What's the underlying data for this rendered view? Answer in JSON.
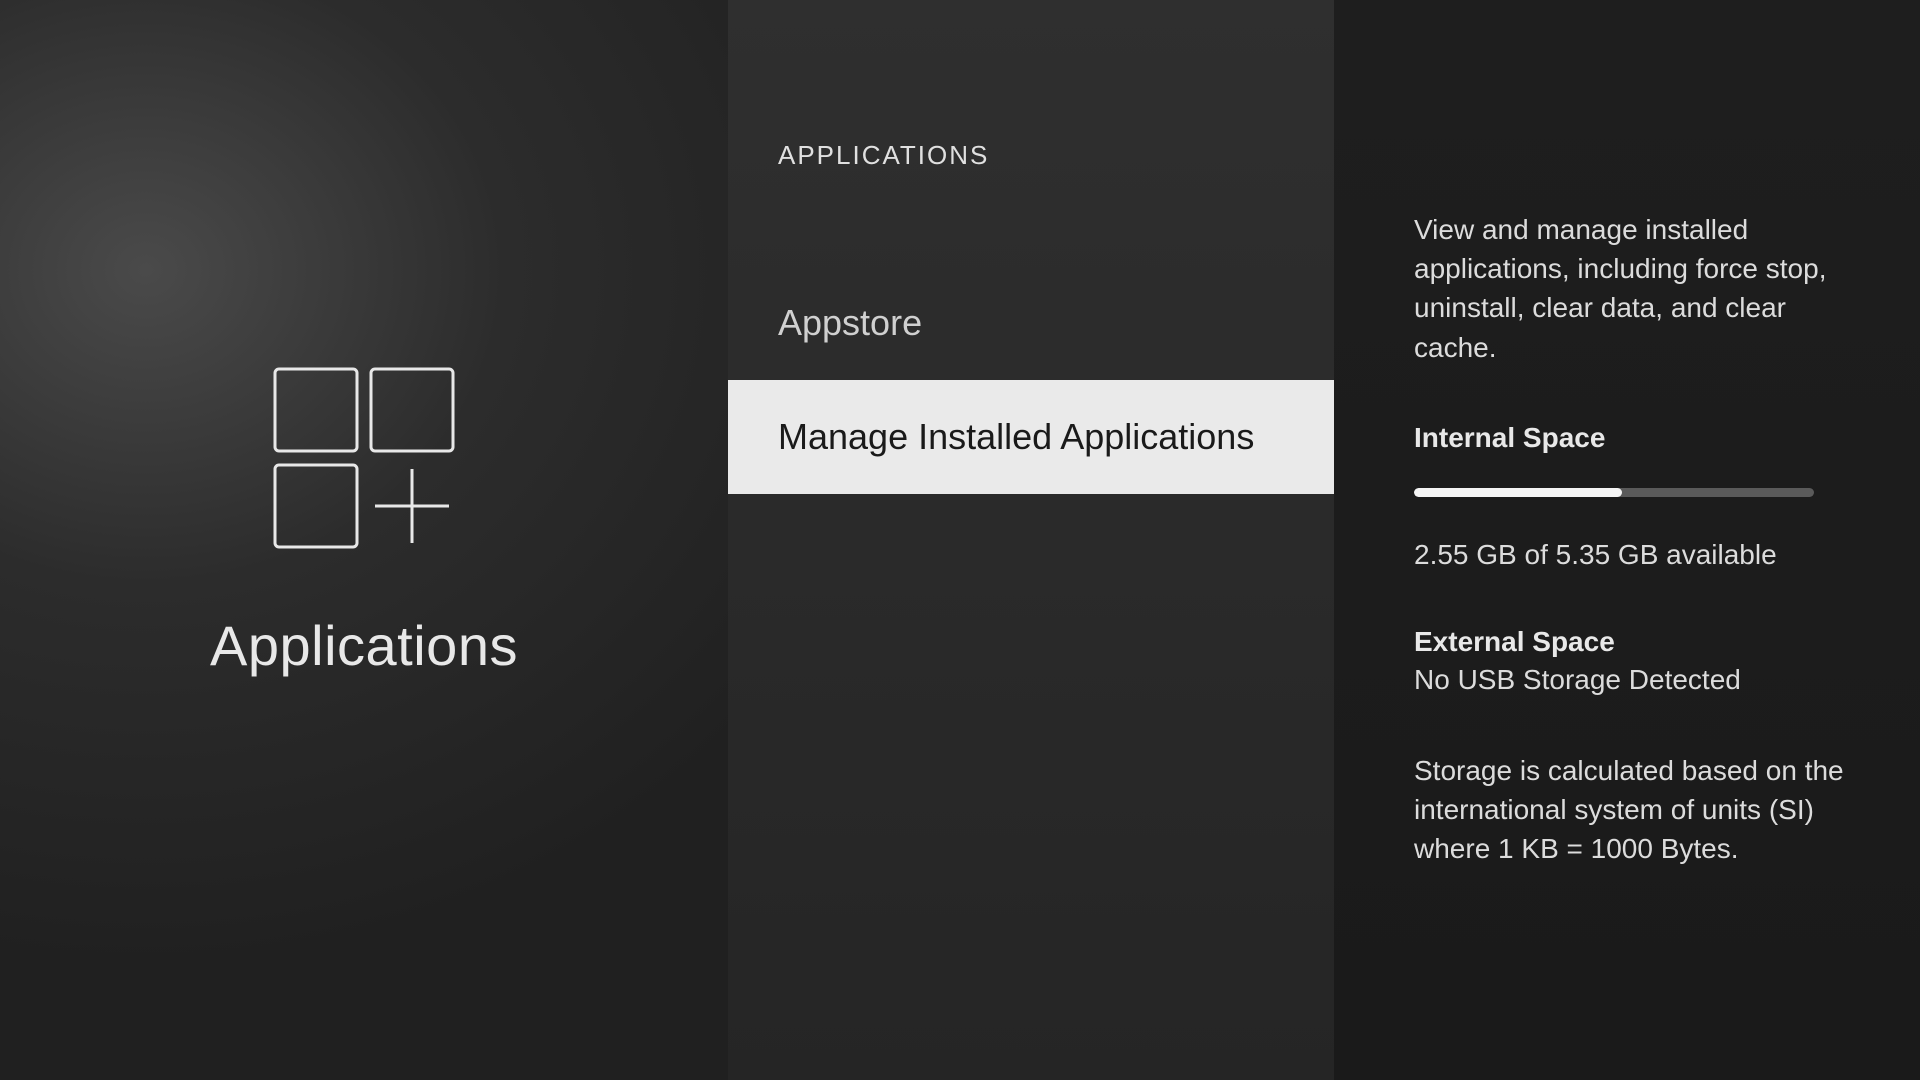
{
  "left": {
    "title": "Applications"
  },
  "middle": {
    "header": "APPLICATIONS",
    "items": [
      {
        "label": "Appstore"
      },
      {
        "label": "Manage Installed Applications"
      }
    ]
  },
  "right": {
    "description": "View and manage installed applications, including force stop, uninstall, clear data, and clear cache.",
    "internal": {
      "title": "Internal Space",
      "used_gb": 2.55,
      "total_gb": 5.35,
      "text": "2.55 GB of 5.35 GB available",
      "progress_pct": 52
    },
    "external": {
      "title": "External Space",
      "text": "No USB Storage Detected"
    },
    "note": "Storage is calculated based on the international system of units (SI) where 1 KB = 1000 Bytes."
  }
}
